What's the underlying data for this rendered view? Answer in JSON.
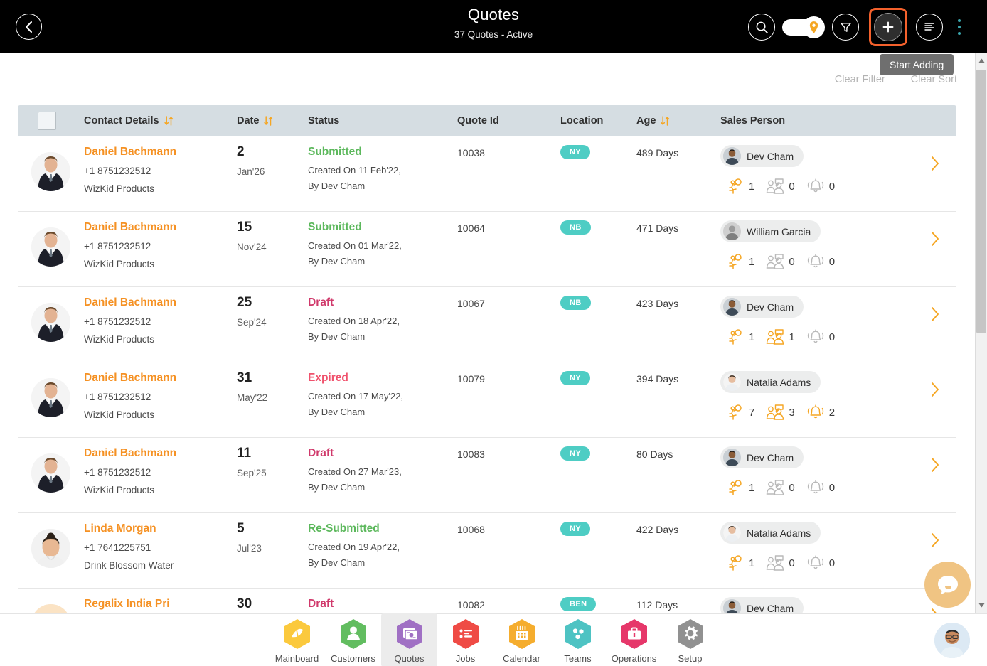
{
  "header": {
    "title": "Quotes",
    "subtitle": "37 Quotes - Active",
    "back_icon": "chevron-left-icon",
    "search_icon": "search-icon",
    "location_toggle_icon": "map-pin-icon",
    "filter_icon": "funnel-icon",
    "add_icon": "plus-icon",
    "list_icon": "list-lines-icon",
    "kebab_icon": "vertical-dots-icon",
    "highlight_color": "#f4612c"
  },
  "tooltip": {
    "text": "Start Adding"
  },
  "sub_actions": {
    "clear_filter": "Clear Filter",
    "clear_sort": "Clear Sort"
  },
  "table": {
    "columns": [
      {
        "key": "check",
        "label": ""
      },
      {
        "key": "contact",
        "label": "Contact Details",
        "sortable": true
      },
      {
        "key": "date",
        "label": "Date",
        "sortable": true
      },
      {
        "key": "status",
        "label": "Status",
        "sortable": false
      },
      {
        "key": "quoteid",
        "label": "Quote Id",
        "sortable": false
      },
      {
        "key": "location",
        "label": "Location",
        "sortable": false
      },
      {
        "key": "age",
        "label": "Age",
        "sortable": true
      },
      {
        "key": "sales",
        "label": "Sales Person",
        "sortable": false
      }
    ],
    "status_colors": {
      "Submitted": "#5cb85c",
      "Re-Submitted": "#5cb85c",
      "Draft": "#d0396b",
      "Expired": "#f0526d"
    },
    "rows": [
      {
        "name": "Daniel Bachmann",
        "phone": "+1 8751232512",
        "company": "WizKid Products",
        "day": "2",
        "month": "Jan'26",
        "status": "Submitted",
        "created": "Created On 11 Feb'22,",
        "created_by": "By Dev Cham",
        "quote_id": "10038",
        "location": "NY",
        "age": "489 Days",
        "sales_person": "Dev Cham",
        "avatar": "man-suit",
        "sales_avatar": "man-dark",
        "counters": [
          {
            "icon": "activity-person-icon",
            "value": "1"
          },
          {
            "icon": "meeting-people-icon",
            "value": "0"
          },
          {
            "icon": "bell-alert-icon",
            "value": "0"
          }
        ]
      },
      {
        "name": "Daniel Bachmann",
        "phone": "+1 8751232512",
        "company": "WizKid Products",
        "day": "15",
        "month": "Nov'24",
        "status": "Submitted",
        "created": "Created On 01 Mar'22,",
        "created_by": "By Dev Cham",
        "quote_id": "10064",
        "location": "NB",
        "age": "471 Days",
        "sales_person": "William Garcia",
        "avatar": "man-suit",
        "sales_avatar": "man-gray",
        "counters": [
          {
            "icon": "activity-person-icon",
            "value": "1"
          },
          {
            "icon": "meeting-people-icon",
            "value": "0"
          },
          {
            "icon": "bell-alert-icon",
            "value": "0"
          }
        ]
      },
      {
        "name": "Daniel Bachmann",
        "phone": "+1 8751232512",
        "company": "WizKid Products",
        "day": "25",
        "month": "Sep'24",
        "status": "Draft",
        "created": "Created On 18 Apr'22,",
        "created_by": "By Dev Cham",
        "quote_id": "10067",
        "location": "NB",
        "age": "423 Days",
        "sales_person": "Dev Cham",
        "avatar": "man-suit",
        "sales_avatar": "man-dark",
        "counters": [
          {
            "icon": "activity-person-icon",
            "value": "1"
          },
          {
            "icon": "meeting-people-icon",
            "value": "1"
          },
          {
            "icon": "bell-alert-icon",
            "value": "0"
          }
        ]
      },
      {
        "name": "Daniel Bachmann",
        "phone": "+1 8751232512",
        "company": "WizKid Products",
        "day": "31",
        "month": "May'22",
        "status": "Expired",
        "created": "Created On 17 May'22,",
        "created_by": "By Dev Cham",
        "quote_id": "10079",
        "location": "NY",
        "age": "394 Days",
        "sales_person": "Natalia Adams",
        "avatar": "man-suit",
        "sales_avatar": "woman-light",
        "counters": [
          {
            "icon": "activity-person-icon",
            "value": "7"
          },
          {
            "icon": "meeting-people-icon",
            "value": "3"
          },
          {
            "icon": "bell-alert-icon",
            "value": "2"
          }
        ]
      },
      {
        "name": "Daniel Bachmann",
        "phone": "+1 8751232512",
        "company": "WizKid Products",
        "day": "11",
        "month": "Sep'25",
        "status": "Draft",
        "created": "Created On 27 Mar'23,",
        "created_by": "By Dev Cham",
        "quote_id": "10083",
        "location": "NY",
        "age": "80 Days",
        "sales_person": "Dev Cham",
        "avatar": "man-suit",
        "sales_avatar": "man-dark",
        "counters": [
          {
            "icon": "activity-person-icon",
            "value": "1"
          },
          {
            "icon": "meeting-people-icon",
            "value": "0"
          },
          {
            "icon": "bell-alert-icon",
            "value": "0"
          }
        ]
      },
      {
        "name": "Linda Morgan",
        "phone": "+1 7641225751",
        "company": "Drink Blossom Water",
        "day": "5",
        "month": "Jul'23",
        "status": "Re-Submitted",
        "created": "Created On 19 Apr'22,",
        "created_by": "By Dev Cham",
        "quote_id": "10068",
        "location": "NY",
        "age": "422 Days",
        "sales_person": "Natalia Adams",
        "avatar": "woman-bun",
        "sales_avatar": "woman-light",
        "counters": [
          {
            "icon": "activity-person-icon",
            "value": "1"
          },
          {
            "icon": "meeting-people-icon",
            "value": "0"
          },
          {
            "icon": "bell-alert-icon",
            "value": "0"
          }
        ]
      },
      {
        "name": "Regalix India Pri",
        "phone": "",
        "company": "",
        "day": "30",
        "month": "",
        "status": "Draft",
        "created": "",
        "created_by": "",
        "quote_id": "10082",
        "location": "BEN",
        "age": "112 Days",
        "sales_person": "Dev Cham",
        "avatar": "blank-orange",
        "sales_avatar": "man-dark",
        "counters": []
      }
    ]
  },
  "scrollbar": {
    "up_icon": "caret-up-icon",
    "down_icon": "caret-down-icon"
  },
  "chat": {
    "icon": "chat-bubble-icon",
    "color": "#f0c483"
  },
  "bottom_nav": {
    "items": [
      {
        "label": "Mainboard",
        "icon": "mainboard-icon",
        "color": "#fbc93d",
        "active": false
      },
      {
        "label": "Customers",
        "icon": "customers-icon",
        "color": "#62bd60",
        "active": false
      },
      {
        "label": "Quotes",
        "icon": "quotes-icon",
        "color": "#a070c4",
        "active": true
      },
      {
        "label": "Jobs",
        "icon": "jobs-icon",
        "color": "#ef4b45",
        "active": false
      },
      {
        "label": "Calendar",
        "icon": "calendar-icon",
        "color": "#f5ad2e",
        "active": false
      },
      {
        "label": "Teams",
        "icon": "teams-icon",
        "color": "#4ec3c3",
        "active": false
      },
      {
        "label": "Operations",
        "icon": "operations-icon",
        "color": "#e6376a",
        "active": false
      },
      {
        "label": "Setup",
        "icon": "setup-icon",
        "color": "#919191",
        "active": false
      }
    ]
  },
  "profile": {
    "icon": "user-avatar"
  }
}
